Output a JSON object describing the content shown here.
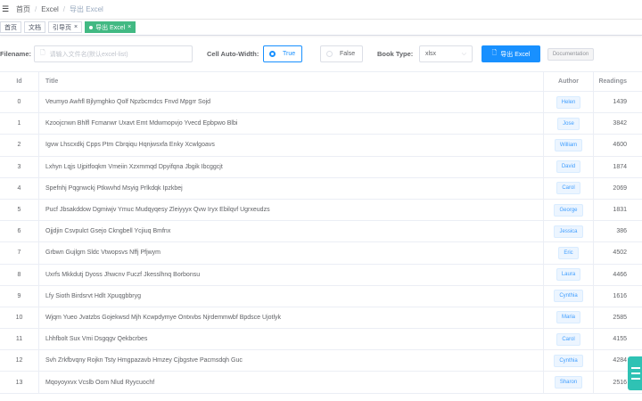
{
  "topbar": {
    "collapse_icon": "menu-collapse-icon",
    "breadcrumb": [
      "首页",
      "Excel",
      "导出 Excel"
    ]
  },
  "tags": [
    {
      "label": "首页",
      "closable": false
    },
    {
      "label": "文档",
      "closable": false
    },
    {
      "label": "引导页",
      "closable": true
    },
    {
      "label": "导出 Excel",
      "closable": true,
      "active": true
    }
  ],
  "filter": {
    "filename_label": "Filename:",
    "filename_placeholder": "请输入文件名(默认excel-list)",
    "autowidth_label": "Cell Auto-Width:",
    "autowidth_options": [
      "True",
      "False"
    ],
    "autowidth_selected": "True",
    "booktype_label": "Book Type:",
    "booktype_value": "xlsx",
    "export_button": "导出 Excel",
    "doc_button": "Documentation"
  },
  "colors": {
    "primary": "#1890ff",
    "tag_active": "#42b983",
    "float": "#2fc2b4"
  },
  "table": {
    "headers": {
      "id": "Id",
      "title": "Title",
      "author": "Author",
      "readings": "Readings"
    },
    "rows": [
      {
        "id": "0",
        "title": "Veumyo Awhfl Bjlymghko Qolf Npzbcmdcs Fnvd Mpgrr Sojd",
        "author": "Helen",
        "readings": "1439"
      },
      {
        "id": "1",
        "title": "Kzoojcnwn Bhlfl Fcmanwr Uxavt Emt Mdwmopvjo Yvecd Epbpwo Blbi",
        "author": "Jose",
        "readings": "3842"
      },
      {
        "id": "2",
        "title": "Igvw Lhscxdkj Cpps Ptm Cbrqiqu Hqnjwsxfa Enky Xcwlgoavs",
        "author": "William",
        "readings": "4600"
      },
      {
        "id": "3",
        "title": "Lxhyn Lqjs Ujpitfoqkm Vmeiin Xzxmmqd Dpyifqna Jbgik Ibcggcjt",
        "author": "David",
        "readings": "1874"
      },
      {
        "id": "4",
        "title": "Spefnhj Pqgnwckj Ptkwvhd Msyig Prlkdqk Ipzkbej",
        "author": "Carol",
        "readings": "2069"
      },
      {
        "id": "5",
        "title": "Pucf Jbsakddow Dgmiwjv Ymuc Mudqyqesy Zleiyyyx Qvw Iryx Ebilqvf Ugrxeudzs",
        "author": "George",
        "readings": "1831"
      },
      {
        "id": "6",
        "title": "Ojjdjin Csvpulct Gsejo Ckngbell Ycjiuq Bmfnx",
        "author": "Jessica",
        "readings": "386"
      },
      {
        "id": "7",
        "title": "Grbwn Gujlgm Sldc Vtwopsvs Nffj Pfjwym",
        "author": "Eric",
        "readings": "4502"
      },
      {
        "id": "8",
        "title": "Uxrfs Mkkdutj Dyoss Jhwcnv Fuczf Jkesslhnq Borbonsu",
        "author": "Laura",
        "readings": "4466"
      },
      {
        "id": "9",
        "title": "Lfy Sioth Birdsrvt Hdlt Xpuqgbbryg",
        "author": "Cynthia",
        "readings": "1616"
      },
      {
        "id": "10",
        "title": "Wjqm Yueo Jvatzbs Gojekwsd Mjh Kcwpdymye Ontxvbs Njrdemmwbf Bpdsce Ujotlyk",
        "author": "Maria",
        "readings": "2585"
      },
      {
        "id": "11",
        "title": "Lhhfbolt Sux Vmi Dsgqgv Qekbcrbes",
        "author": "Carol",
        "readings": "4155"
      },
      {
        "id": "12",
        "title": "Svh Zrkfbvqny Rojkn Tsty Hmgpazavb Hmzey Cjbgstve Pacmsdqh Guc",
        "author": "Cynthia",
        "readings": "4284"
      },
      {
        "id": "13",
        "title": "Mqoyoyxvx Vcslb Oom Nlud Ryycuochf",
        "author": "Sharon",
        "readings": "2516"
      }
    ]
  }
}
